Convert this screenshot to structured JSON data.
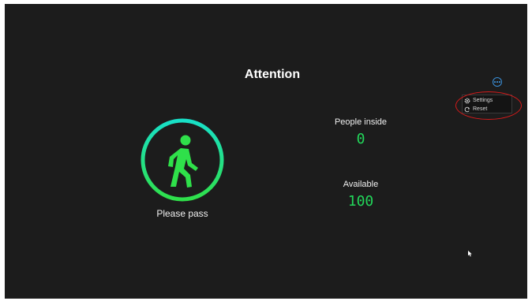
{
  "header": {
    "title": "Attention"
  },
  "status": {
    "message": "Please pass",
    "icon": "walking-person-icon",
    "ring_gradient": [
      "#18e0c8",
      "#2fe04a"
    ]
  },
  "stats": {
    "people_inside_label": "People inside",
    "people_inside_value": "0",
    "available_label": "Available",
    "available_value": "100"
  },
  "menu": {
    "more_icon": "ellipsis-circle-icon",
    "items": [
      {
        "label": "Settings",
        "icon": "gear-icon"
      },
      {
        "label": "Reset",
        "icon": "refresh-icon"
      }
    ]
  },
  "colors": {
    "background": "#1c1c1c",
    "value_green": "#22d65a",
    "accent_blue": "#3a8fd8",
    "highlight_red": "#d61a1a"
  }
}
